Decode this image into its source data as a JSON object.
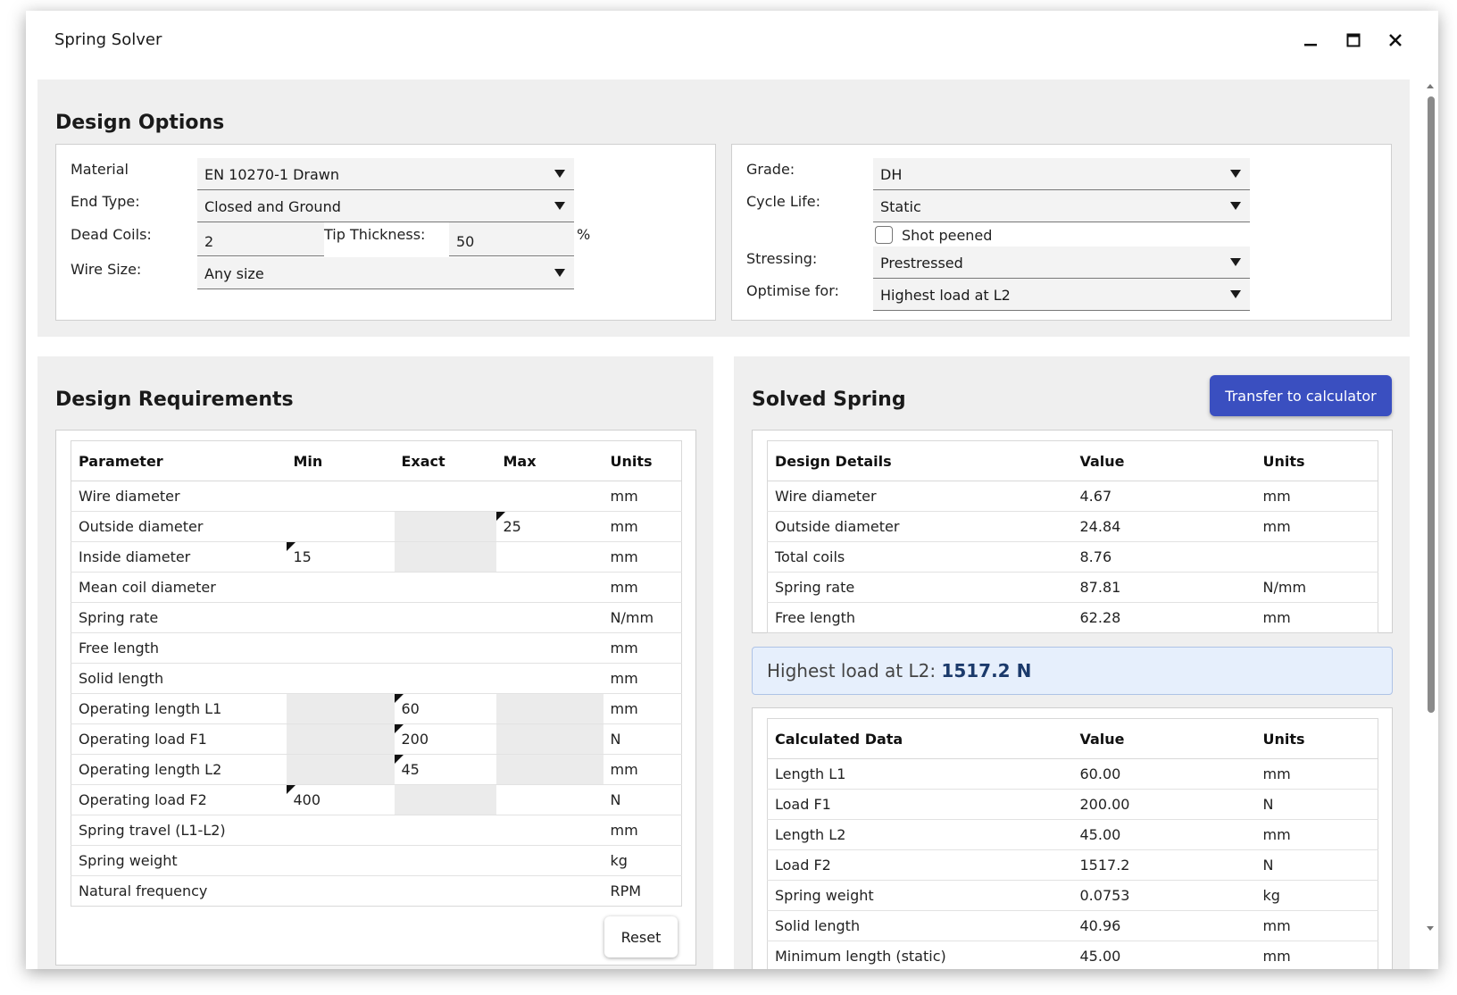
{
  "app": {
    "title": "Spring Solver"
  },
  "design_options": {
    "title": "Design Options",
    "material_label": "Material",
    "material_value": "EN 10270-1 Drawn",
    "end_type_label": "End Type:",
    "end_type_value": "Closed and Ground",
    "dead_coils_label": "Dead Coils:",
    "dead_coils_value": "2",
    "tip_thickness_label": "Tip Thickness:",
    "tip_thickness_value": "50",
    "tip_thickness_unit": "%",
    "wire_size_label": "Wire Size:",
    "wire_size_value": "Any size",
    "grade_label": "Grade:",
    "grade_value": "DH",
    "cycle_life_label": "Cycle Life:",
    "cycle_life_value": "Static",
    "shot_peened_label": "Shot peened",
    "stressing_label": "Stressing:",
    "stressing_value": "Prestressed",
    "optimise_label": "Optimise for:",
    "optimise_value": "Highest load at L2"
  },
  "design_requirements": {
    "title": "Design Requirements",
    "headers": [
      "Parameter",
      "Min",
      "Exact",
      "Max",
      "Units"
    ],
    "rows": [
      {
        "param": "Wire diameter",
        "min": "",
        "exact": "",
        "max": "",
        "units": "mm"
      },
      {
        "param": "Outside diameter",
        "min": "",
        "exact": "",
        "max": "25",
        "units": "mm"
      },
      {
        "param": "Inside diameter",
        "min": "15",
        "exact": "",
        "max": "",
        "units": "mm"
      },
      {
        "param": "Mean coil diameter",
        "min": "",
        "exact": "",
        "max": "",
        "units": "mm"
      },
      {
        "param": "Spring rate",
        "min": "",
        "exact": "",
        "max": "",
        "units": "N/mm"
      },
      {
        "param": "Free length",
        "min": "",
        "exact": "",
        "max": "",
        "units": "mm"
      },
      {
        "param": "Solid length",
        "min": "",
        "exact": "",
        "max": "",
        "units": "mm"
      },
      {
        "param": "Operating length L1",
        "min": "",
        "exact": "60",
        "max": "",
        "units": "mm"
      },
      {
        "param": "Operating load F1",
        "min": "",
        "exact": "200",
        "max": "",
        "units": "N"
      },
      {
        "param": "Operating length L2",
        "min": "",
        "exact": "45",
        "max": "",
        "units": "mm"
      },
      {
        "param": "Operating load F2",
        "min": "400",
        "exact": "",
        "max": "",
        "units": "N"
      },
      {
        "param": "Spring travel (L1-L2)",
        "min": "",
        "exact": "",
        "max": "",
        "units": "mm"
      },
      {
        "param": "Spring weight",
        "min": "",
        "exact": "",
        "max": "",
        "units": "kg"
      },
      {
        "param": "Natural frequency",
        "min": "",
        "exact": "",
        "max": "",
        "units": "RPM"
      }
    ],
    "reset_label": "Reset"
  },
  "solved_spring": {
    "title": "Solved Spring",
    "transfer_label": "Transfer to calculator",
    "design_headers": [
      "Design Details",
      "Value",
      "Units"
    ],
    "design_rows": [
      {
        "name": "Wire diameter",
        "value": "4.67",
        "units": "mm"
      },
      {
        "name": "Outside diameter",
        "value": "24.84",
        "units": "mm"
      },
      {
        "name": "Total coils",
        "value": "8.76",
        "units": ""
      },
      {
        "name": "Spring rate",
        "value": "87.81",
        "units": "N/mm"
      },
      {
        "name": "Free length",
        "value": "62.28",
        "units": "mm"
      }
    ],
    "highlight_label": "Highest load at L2:",
    "highlight_value": "1517.2 N",
    "calc_headers": [
      "Calculated Data",
      "Value",
      "Units"
    ],
    "calc_rows": [
      {
        "name": "Length L1",
        "value": "60.00",
        "units": "mm"
      },
      {
        "name": "Load F1",
        "value": "200.00",
        "units": "N"
      },
      {
        "name": "Length L2",
        "value": "45.00",
        "units": "mm"
      },
      {
        "name": "Load F2",
        "value": "1517.2",
        "units": "N"
      },
      {
        "name": "Spring weight",
        "value": "0.0753",
        "units": "kg"
      },
      {
        "name": "Solid length",
        "value": "40.96",
        "units": "mm"
      },
      {
        "name": "Minimum length (static)",
        "value": "45.00",
        "units": "mm"
      }
    ]
  }
}
